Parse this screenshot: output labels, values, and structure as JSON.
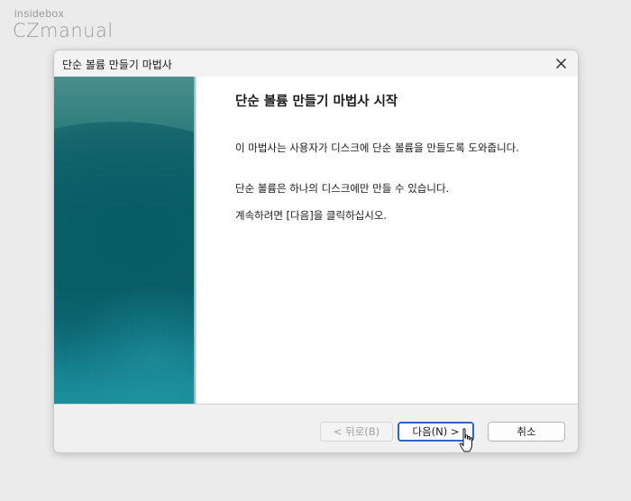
{
  "watermark": {
    "top": "insidebox",
    "bottom": "CZmanual"
  },
  "window": {
    "title": "단순 볼륨 만들기 마법사",
    "close_icon": "close-icon"
  },
  "wizard": {
    "heading": "단순 볼륨 만들기 마법사 시작",
    "paragraph1": "이 마법사는 사용자가 디스크에 단순 볼륨을 만들도록 도와줍니다.",
    "paragraph2": "단순 볼륨은 하나의 디스크에만 만들 수 있습니다.",
    "paragraph3": "계속하려면 [다음]을 클릭하십시오."
  },
  "buttons": {
    "back": "< 뒤로(B)",
    "next": "다음(N) >",
    "cancel": "취소"
  },
  "colors": {
    "accent_focus": "#2a63c9",
    "banner": "#0e6a72"
  }
}
